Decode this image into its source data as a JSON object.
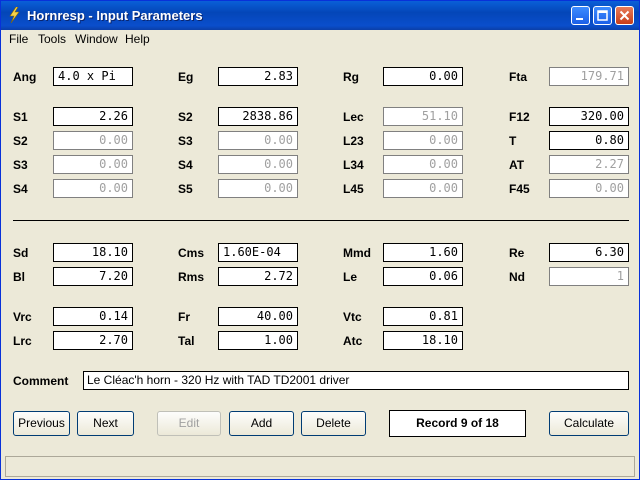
{
  "window": {
    "title": "Hornresp - Input Parameters"
  },
  "menu": [
    "File",
    "Tools",
    "Window",
    "Help"
  ],
  "params": {
    "Ang": {
      "label": "Ang",
      "value": "4.0 x Pi",
      "disabled": false
    },
    "Eg": {
      "label": "Eg",
      "value": "2.83",
      "disabled": false
    },
    "Rg": {
      "label": "Rg",
      "value": "0.00",
      "disabled": false
    },
    "Fta": {
      "label": "Fta",
      "value": "179.71",
      "disabled": true
    },
    "S1": {
      "label": "S1",
      "value": "2.26",
      "disabled": false
    },
    "S2a": {
      "label": "S2",
      "value": "2838.86",
      "disabled": false
    },
    "Lec": {
      "label": "Lec",
      "value": "51.10",
      "disabled": true
    },
    "F12": {
      "label": "F12",
      "value": "320.00",
      "disabled": false
    },
    "S2": {
      "label": "S2",
      "value": "0.00",
      "disabled": true
    },
    "S3a": {
      "label": "S3",
      "value": "0.00",
      "disabled": true
    },
    "L23": {
      "label": "L23",
      "value": "0.00",
      "disabled": true
    },
    "T": {
      "label": "T",
      "value": "0.80",
      "disabled": false
    },
    "S3": {
      "label": "S3",
      "value": "0.00",
      "disabled": true
    },
    "S4a": {
      "label": "S4",
      "value": "0.00",
      "disabled": true
    },
    "L34": {
      "label": "L34",
      "value": "0.00",
      "disabled": true
    },
    "AT": {
      "label": "AT",
      "value": "2.27",
      "disabled": true
    },
    "S4": {
      "label": "S4",
      "value": "0.00",
      "disabled": true
    },
    "S5": {
      "label": "S5",
      "value": "0.00",
      "disabled": true
    },
    "L45": {
      "label": "L45",
      "value": "0.00",
      "disabled": true
    },
    "F45": {
      "label": "F45",
      "value": "0.00",
      "disabled": true
    },
    "Sd": {
      "label": "Sd",
      "value": "18.10",
      "disabled": false
    },
    "Cms": {
      "label": "Cms",
      "value": "1.60E-04",
      "disabled": false
    },
    "Mmd": {
      "label": "Mmd",
      "value": "1.60",
      "disabled": false
    },
    "Re": {
      "label": "Re",
      "value": "6.30",
      "disabled": false
    },
    "Bl": {
      "label": "Bl",
      "value": "7.20",
      "disabled": false
    },
    "Rms": {
      "label": "Rms",
      "value": "2.72",
      "disabled": false
    },
    "Le": {
      "label": "Le",
      "value": "0.06",
      "disabled": false
    },
    "Nd": {
      "label": "Nd",
      "value": "1",
      "disabled": true
    },
    "Vrc": {
      "label": "Vrc",
      "value": "0.14",
      "disabled": false
    },
    "Fr": {
      "label": "Fr",
      "value": "40.00",
      "disabled": false
    },
    "Vtc": {
      "label": "Vtc",
      "value": "0.81",
      "disabled": false
    },
    "Lrc": {
      "label": "Lrc",
      "value": "2.70",
      "disabled": false
    },
    "Tal": {
      "label": "Tal",
      "value": "1.00",
      "disabled": false
    },
    "Atc": {
      "label": "Atc",
      "value": "18.10",
      "disabled": false
    }
  },
  "comment": {
    "label": "Comment",
    "value": "Le Cléac'h horn - 320 Hz with TAD TD2001 driver"
  },
  "buttons": {
    "previous": "Previous",
    "next": "Next",
    "edit": "Edit",
    "add": "Add",
    "delete": "Delete",
    "calculate": "Calculate"
  },
  "record": "Record 9 of 18",
  "colors": {
    "titlebar": "#0a4ecc",
    "window_bg": "#ece9d8",
    "disabled_text": "#a0a0a0"
  }
}
